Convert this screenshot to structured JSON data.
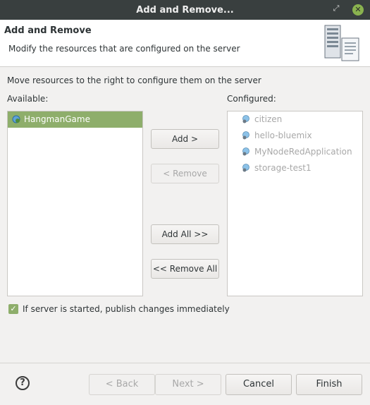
{
  "window": {
    "title": "Add and Remove...",
    "restore_glyph": "⤢",
    "close_glyph": "✕"
  },
  "header": {
    "title": "Add and Remove",
    "description": "Modify the resources that are configured on the server",
    "icon": "server-icon"
  },
  "instructions": "Move resources to the right to configure them on the server",
  "available": {
    "label": "Available:",
    "items": [
      {
        "label": "HangmanGame",
        "icon": "web-project-icon",
        "selected": true
      }
    ]
  },
  "configured": {
    "label": "Configured:",
    "items": [
      {
        "label": "citizen",
        "icon": "cloud-app-icon"
      },
      {
        "label": "hello-bluemix",
        "icon": "cloud-app-icon"
      },
      {
        "label": "MyNodeRedApplication",
        "icon": "cloud-app-icon"
      },
      {
        "label": "storage-test1",
        "icon": "cloud-app-icon"
      }
    ]
  },
  "buttons": {
    "add": "Add >",
    "remove": "< Remove",
    "add_all": "Add All >>",
    "remove_all": "<< Remove All"
  },
  "publish_option": {
    "label": "If server is started, publish changes immediately",
    "checked": true
  },
  "footer": {
    "help_glyph": "?",
    "back": "< Back",
    "next": "Next >",
    "cancel": "Cancel",
    "finish": "Finish"
  },
  "colors": {
    "selection": "#8eae6b",
    "titlebar": "#393f3f",
    "close_button": "#8ab34f"
  }
}
